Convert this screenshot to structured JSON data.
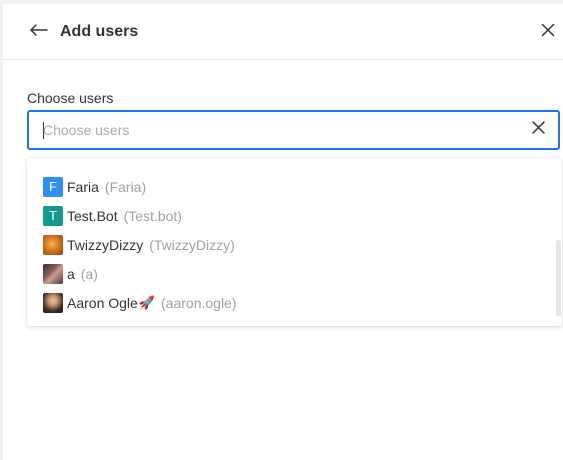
{
  "header": {
    "title": "Add users",
    "back_icon": "arrow-back-icon",
    "close_icon": "close-icon"
  },
  "field": {
    "label": "Choose users",
    "placeholder": "Choose users",
    "value": ""
  },
  "options": [
    {
      "name": "Faria",
      "username": "(Faria)",
      "avatar_letter": "F",
      "avatar_color": "#2e8ef5",
      "avatar_icon": "letter-avatar"
    },
    {
      "name": "Test.Bot",
      "username": "(Test.bot)",
      "avatar_letter": "T",
      "avatar_color": "#11998e",
      "avatar_icon": "letter-avatar"
    },
    {
      "name": "TwizzyDizzy",
      "username": "(TwizzyDizzy)",
      "avatar_icon": "photo-avatar"
    },
    {
      "name": "a",
      "username": "(a)",
      "avatar_icon": "photo-avatar"
    },
    {
      "name": "Aaron Ogle",
      "name_emoji": "🚀",
      "username": "(aaron.ogle)",
      "avatar_icon": "photo-avatar"
    }
  ],
  "colors": {
    "accent": "#1d74f5",
    "text": "#2f343d",
    "muted": "#9ea2a8"
  }
}
